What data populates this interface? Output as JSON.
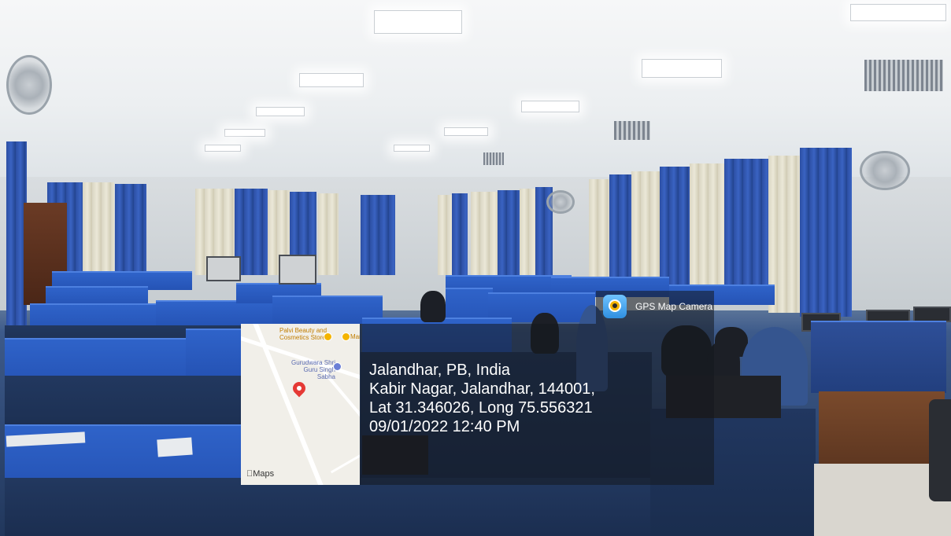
{
  "photo": {
    "scene": "computer-lab",
    "colors": {
      "curtain_blue": "#2c4fa3",
      "cubicle_blue": "#2f63c9",
      "overlay": "rgba(20,24,30,0.55)"
    }
  },
  "badge": {
    "label": "GPS Map Camera",
    "icon": "gps-map-camera-app-icon"
  },
  "map": {
    "poi_1": "Palvi Beauty and Cosmetics Store",
    "poi_2": "Mar",
    "poi_3": "Gurudwara Shri Guru Singh Sabha",
    "brand": "Maps",
    "pin_icon": "location-pin-icon"
  },
  "location": {
    "city_line": "Jalandhar, PB, India",
    "address_line": "Kabir Nagar, Jalandhar, 144001,",
    "coords_line": "Lat 31.346026, Long 75.556321",
    "datetime_line": "09/01/2022 12:40 PM"
  }
}
